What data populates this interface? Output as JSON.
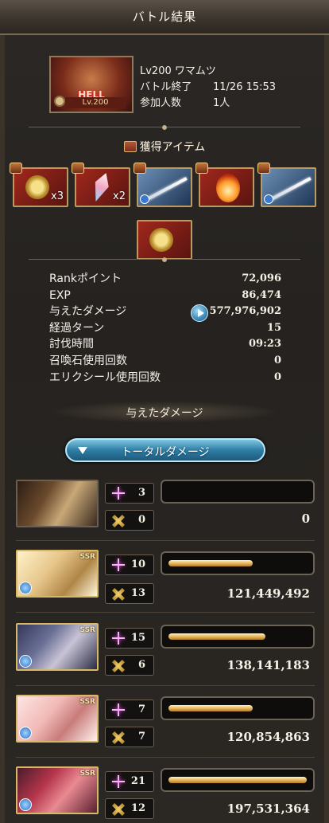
{
  "header": {
    "title": "バトル結果"
  },
  "quest": {
    "thumb_badge": "HELL",
    "thumb_level": "Lv.200",
    "name": "Lv200 ワマムツ",
    "end_label": "バトル終了",
    "end_time": "11/26 15:53",
    "participants_label": "参加人数",
    "participants_value": "1人"
  },
  "items": {
    "heading": "獲得アイテム",
    "list": [
      {
        "icon": "gold-medal-icon",
        "count": "x3"
      },
      {
        "icon": "crystal-icon",
        "count": "x2"
      },
      {
        "icon": "silver-sword-icon",
        "count": ""
      },
      {
        "icon": "flame-orb-icon",
        "count": ""
      },
      {
        "icon": "spear-icon",
        "count": ""
      },
      {
        "icon": "gold-medal-icon",
        "count": ""
      }
    ]
  },
  "stats": [
    {
      "label": "Rankポイント",
      "value": "72,096"
    },
    {
      "label": "EXP",
      "value": "86,474"
    },
    {
      "label": "与えたダメージ",
      "value": "577,976,902"
    },
    {
      "label": "経過ターン",
      "value": "15"
    },
    {
      "label": "討伐時間",
      "value": "09:23"
    },
    {
      "label": "召喚石使用回数",
      "value": "0"
    },
    {
      "label": "エリクシール使用回数",
      "value": "0"
    }
  ],
  "damage_section": {
    "heading": "与えたダメージ",
    "total_button": "トータルダメージ"
  },
  "members": [
    {
      "skills": "3",
      "attacks": "0",
      "damage": "0",
      "bar_fill": 0.0,
      "ssr": ""
    },
    {
      "skills": "10",
      "attacks": "13",
      "damage": "121,449,492",
      "bar_fill": 0.61,
      "ssr": "SSR"
    },
    {
      "skills": "15",
      "attacks": "6",
      "damage": "138,141,183",
      "bar_fill": 0.7,
      "ssr": "SSR"
    },
    {
      "skills": "7",
      "attacks": "7",
      "damage": "120,854,863",
      "bar_fill": 0.61,
      "ssr": "SSR"
    },
    {
      "skills": "21",
      "attacks": "12",
      "damage": "197,531,364",
      "bar_fill": 1.0,
      "ssr": "SSR"
    }
  ],
  "colors": {
    "accent_gold": "#e8b75d",
    "button_blue": "#2f7ea6"
  }
}
